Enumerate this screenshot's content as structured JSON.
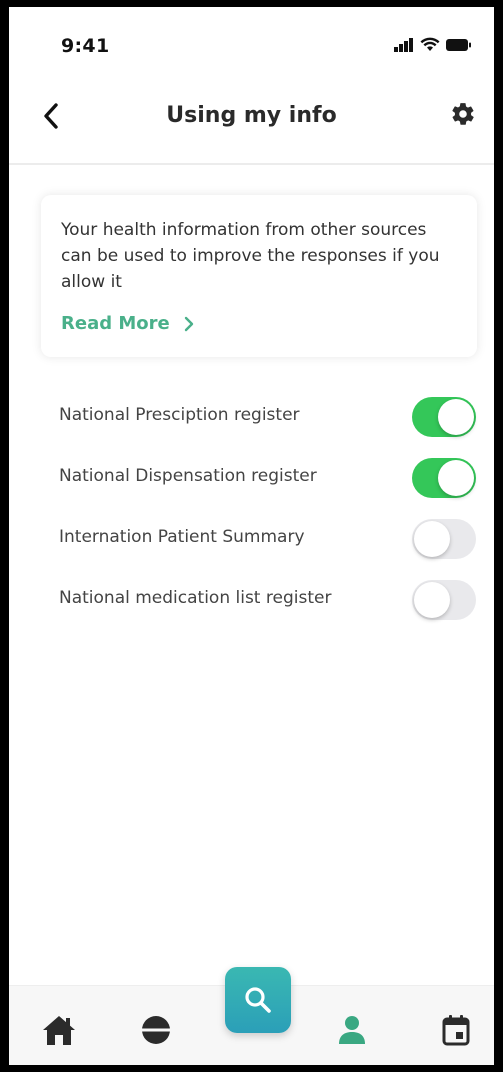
{
  "status_bar": {
    "time": "9:41"
  },
  "header": {
    "title": "Using my info"
  },
  "info_card": {
    "text": "Your health information from other sources can be used to improve the responses if you allow it",
    "read_more_label": "Read More"
  },
  "toggles": [
    {
      "label": "National Presciption register",
      "on": true
    },
    {
      "label": "National Dispensation register",
      "on": true
    },
    {
      "label": "Internation Patient Summary",
      "on": false
    },
    {
      "label": "National medication list register",
      "on": false
    }
  ],
  "bottom_nav": {
    "items": [
      {
        "icon": "home-icon"
      },
      {
        "icon": "pill-icon"
      },
      {
        "icon": "search-icon"
      },
      {
        "icon": "profile-icon",
        "active": true
      },
      {
        "icon": "calendar-icon"
      }
    ]
  },
  "colors": {
    "accent": "#4ab08a",
    "toggle_on": "#34c759",
    "toggle_off": "#e9e9ec",
    "search_button": "#2fa9b6",
    "nav_icon": "#2b2b2b",
    "nav_active": "#3aa882"
  }
}
